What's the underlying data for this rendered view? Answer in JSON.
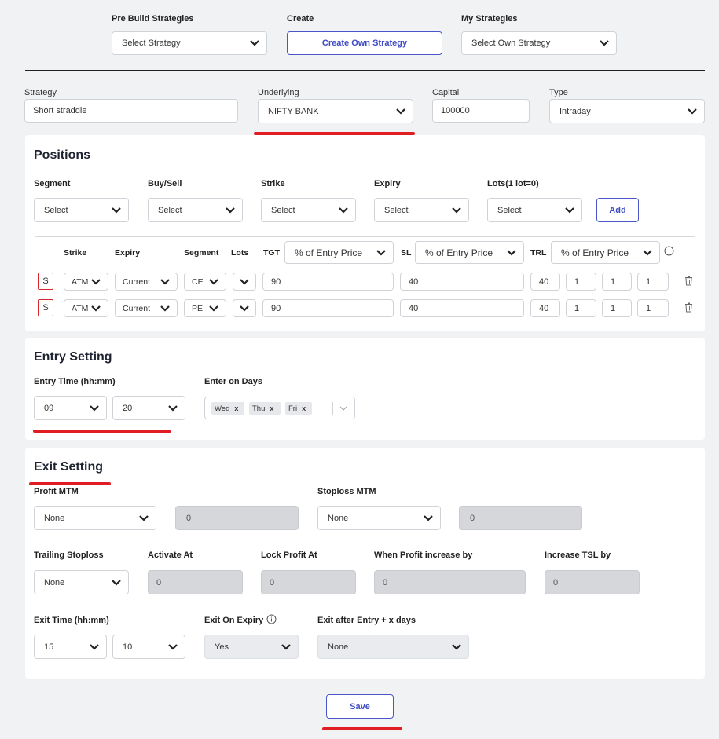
{
  "top": {
    "prebuild_label": "Pre Build Strategies",
    "prebuild_value": "Select Strategy",
    "create_label": "Create",
    "create_button": "Create Own Strategy",
    "my_label": "My Strategies",
    "my_value": "Select Own Strategy"
  },
  "config": {
    "strategy_label": "Strategy",
    "strategy_value": "Short straddle",
    "underlying_label": "Underlying",
    "underlying_value": "NIFTY BANK",
    "capital_label": "Capital",
    "capital_value": "100000",
    "type_label": "Type",
    "type_value": "Intraday"
  },
  "positions": {
    "title": "Positions",
    "segment_label": "Segment",
    "buysell_label": "Buy/Sell",
    "strike_label": "Strike",
    "expiry_label": "Expiry",
    "lots_label": "Lots(1 lot=0)",
    "select_placeholder": "Select",
    "add_button": "Add",
    "table": {
      "h_strike": "Strike",
      "h_expiry": "Expiry",
      "h_segment": "Segment",
      "h_lots": "Lots",
      "h_tgt": "TGT",
      "tgt_mode": "% of Entry Price",
      "h_sl": "SL",
      "sl_mode": "% of Entry Price",
      "h_trl": "TRL",
      "trl_mode": "% of Entry Price",
      "rows": [
        {
          "side": "S",
          "strike": "ATM",
          "expiry": "Current",
          "segment": "CE",
          "lots": "",
          "tgt": "90",
          "sl": "40",
          "trl": "40",
          "v1": "1",
          "v2": "1",
          "v3": "1"
        },
        {
          "side": "S",
          "strike": "ATM",
          "expiry": "Current",
          "segment": "PE",
          "lots": "",
          "tgt": "90",
          "sl": "40",
          "trl": "40",
          "v1": "1",
          "v2": "1",
          "v3": "1"
        }
      ]
    }
  },
  "entry": {
    "title": "Entry Setting",
    "time_label": "Entry Time (hh:mm)",
    "hour": "09",
    "minute": "20",
    "days_label": "Enter on Days",
    "days": [
      "Wed",
      "Thu",
      "Fri"
    ]
  },
  "exit": {
    "title": "Exit Setting",
    "profit_mtm_label": "Profit MTM",
    "profit_mtm_value": "None",
    "profit_mtm_amount": "0",
    "stoploss_mtm_label": "Stoploss MTM",
    "stoploss_mtm_value": "None",
    "stoploss_mtm_amount": "0",
    "trailing_label": "Trailing Stoploss",
    "trailing_value": "None",
    "activate_label": "Activate At",
    "activate_value": "0",
    "lock_label": "Lock Profit At",
    "lock_value": "0",
    "increase_label": "When Profit increase by",
    "increase_value": "0",
    "tsl_label": "Increase TSL by",
    "tsl_value": "0",
    "time_label": "Exit Time (hh:mm)",
    "hour": "15",
    "minute": "10",
    "expiry_label": "Exit On Expiry",
    "expiry_value": "Yes",
    "after_label": "Exit after Entry + x days",
    "after_value": "None"
  },
  "save_button": "Save",
  "colors": {
    "accent": "#3f4bc4",
    "highlight": "#e11c23",
    "disabled": "#d5d7da"
  }
}
